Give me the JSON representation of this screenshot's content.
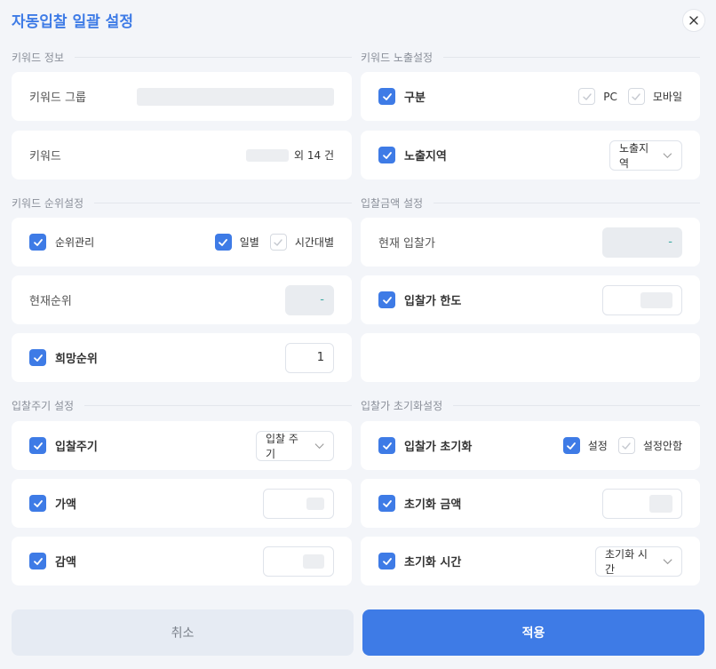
{
  "dialog": {
    "title": "자동입찰 일괄 설정",
    "close_icon": "close-icon"
  },
  "colors": {
    "accent": "#3e7be6",
    "background": "#f3f5f9",
    "card": "#ffffff",
    "muted_text": "#8a8f99"
  },
  "keyword_info": {
    "section_title": "키워드 정보",
    "group_label": "키워드 그룹",
    "keyword_label": "키워드",
    "keyword_count_text": "외 14 건"
  },
  "keyword_exposure": {
    "section_title": "키워드 노출설정",
    "division_label": "구분",
    "division_checked": true,
    "pc_label": "PC",
    "pc_checked": false,
    "mobile_label": "모바일",
    "mobile_checked": false,
    "region_label": "노출지역",
    "region_checked": true,
    "region_select": "노출지역"
  },
  "keyword_rank": {
    "section_title": "키워드 순위설정",
    "rank_mgmt_label": "순위관리",
    "rank_mgmt_checked": true,
    "daily_label": "일별",
    "daily_checked": true,
    "hourly_label": "시간대별",
    "hourly_checked": false,
    "current_rank_label": "현재순위",
    "current_rank_value": "-",
    "desired_rank_label": "희망순위",
    "desired_rank_checked": true,
    "desired_rank_value": "1"
  },
  "bid_amount": {
    "section_title": "입찰금액 설정",
    "current_bid_label": "현재 입찰가",
    "current_bid_value": "-",
    "bid_limit_label": "입찰가 한도",
    "bid_limit_checked": true
  },
  "bid_cycle": {
    "section_title": "입찰주기 설정",
    "cycle_label": "입찰주기",
    "cycle_checked": true,
    "cycle_select": "입찰 주기",
    "add_label": "가액",
    "add_checked": true,
    "subtract_label": "감액",
    "subtract_checked": true
  },
  "bid_reset": {
    "section_title": "입찰가 초기화설정",
    "reset_label": "입찰가 초기화",
    "reset_checked": true,
    "set_label": "설정",
    "set_checked": true,
    "unset_label": "설정안함",
    "unset_checked": false,
    "reset_amount_label": "초기화 금액",
    "reset_amount_checked": true,
    "reset_time_label": "초기화 시간",
    "reset_time_checked": true,
    "reset_time_select": "초기화 시간"
  },
  "footer": {
    "cancel_label": "취소",
    "apply_label": "적용"
  }
}
